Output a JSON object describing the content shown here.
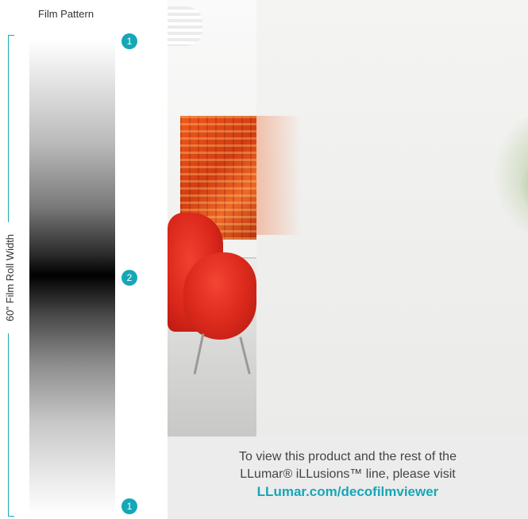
{
  "film_pattern": {
    "title": "Film Pattern",
    "width_label": "60\" Film Roll Width",
    "markers": {
      "top": "1",
      "middle": "2",
      "bottom": "1"
    }
  },
  "caption": {
    "line1": "To view this product and the rest of the",
    "line2": "LLumar® iLLusions™ line, please visit",
    "link": "LLumar.com/decofilmviewer"
  },
  "colors": {
    "accent": "#16a7b7",
    "caption_bg": "#ececec"
  }
}
